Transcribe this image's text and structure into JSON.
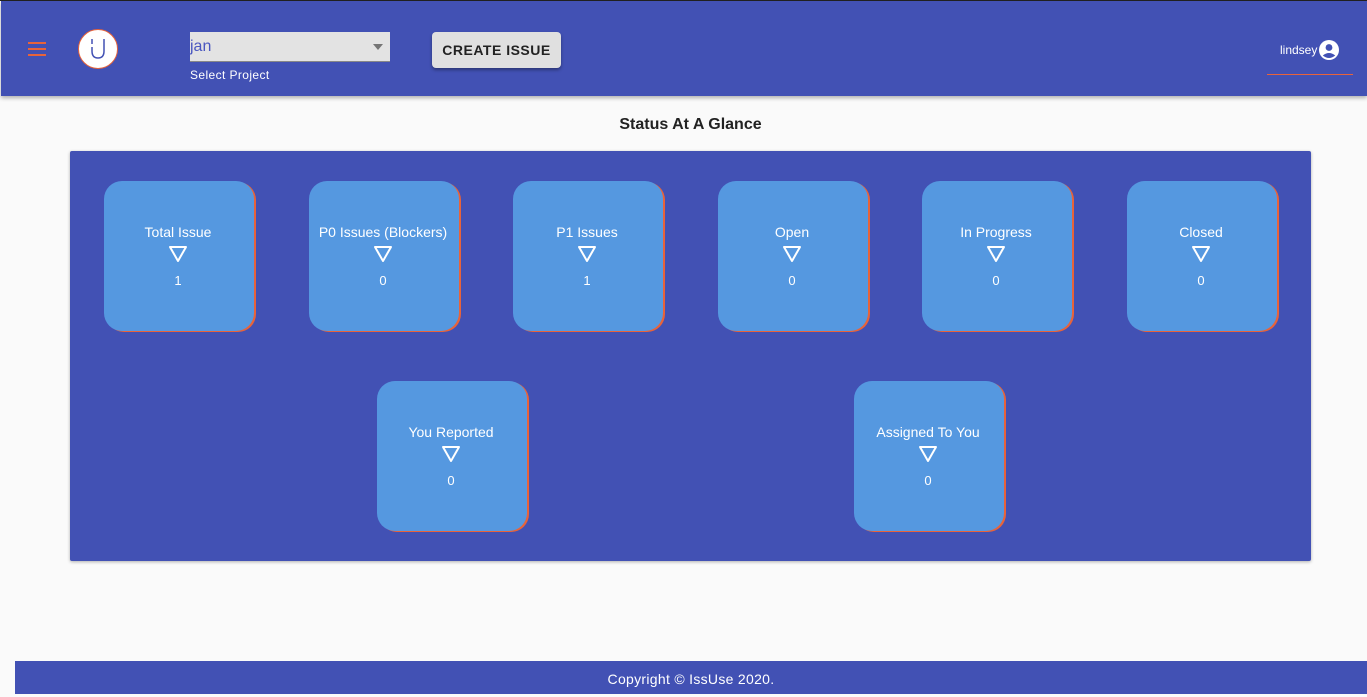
{
  "header": {
    "project_value": "jan",
    "project_helper": "Select Project",
    "create_issue_label": "CREATE ISSUE",
    "username": "lindsey",
    "accent_color": "#e8633a",
    "bar_color": "#4251b4"
  },
  "main": {
    "heading": "Status At A Glance",
    "cards": [
      {
        "label": "Total Issue",
        "count": "1"
      },
      {
        "label": "P0 Issues (Blockers)",
        "count": "0"
      },
      {
        "label": "P1 Issues",
        "count": "1"
      },
      {
        "label": "Open",
        "count": "0"
      },
      {
        "label": "In Progress",
        "count": "0"
      },
      {
        "label": "Closed",
        "count": "0"
      },
      {
        "label": "You Reported",
        "count": "0"
      },
      {
        "label": "Assigned To You",
        "count": "0"
      }
    ],
    "card_icon": "triangle-down-outline-icon"
  },
  "footer": {
    "copyright": "Copyright © IssUse 2020."
  }
}
